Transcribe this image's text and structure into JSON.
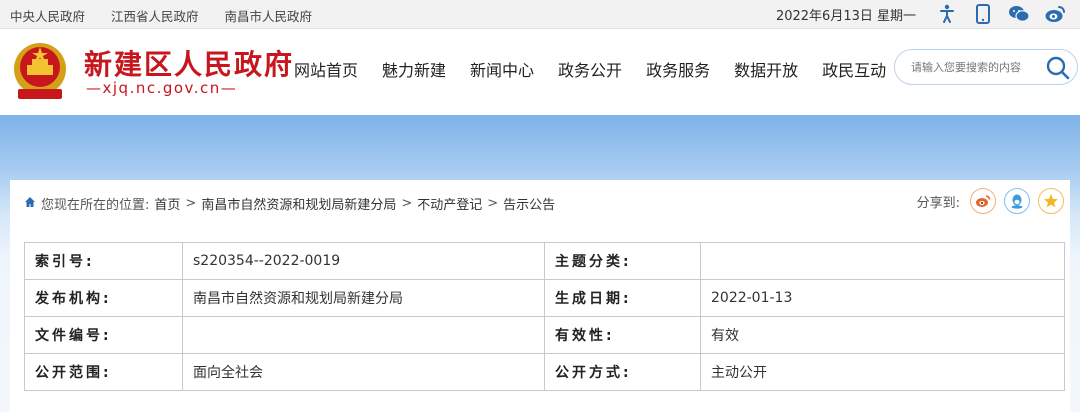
{
  "topbar": {
    "links": [
      "中央人民政府",
      "江西省人民政府",
      "南昌市人民政府"
    ],
    "date": "2022年6月13日 星期一",
    "icons": [
      "accessibility-icon",
      "mobile-icon",
      "wechat-icon",
      "weibo-icon"
    ]
  },
  "header": {
    "site_name": "新建区人民政府",
    "domain": "xjq.nc.gov.cn",
    "nav": [
      "网站首页",
      "魅力新建",
      "新闻中心",
      "政务公开",
      "政务服务",
      "数据开放",
      "政民互动"
    ],
    "search_placeholder": "请输入您要搜索的内容"
  },
  "breadcrumb": {
    "prefix": "您现在所在的位置:",
    "items": [
      "首页",
      "南昌市自然资源和规划局新建分局",
      "不动产登记",
      "告示公告"
    ],
    "separator": ">"
  },
  "share": {
    "label": "分享到:",
    "icons": [
      "weibo-share-icon",
      "qq-share-icon",
      "qzone-share-icon"
    ]
  },
  "info_table": {
    "rows": [
      [
        {
          "k": "索引号:",
          "v": "s220354--2022-0019"
        },
        {
          "k": "主题分类:",
          "v": ""
        }
      ],
      [
        {
          "k": "发布机构:",
          "v": "南昌市自然资源和规划局新建分局"
        },
        {
          "k": "生成日期:",
          "v": "2022-01-13"
        }
      ],
      [
        {
          "k": "文件编号:",
          "v": ""
        },
        {
          "k": "有效性:",
          "v": "有效"
        }
      ],
      [
        {
          "k": "公开范围:",
          "v": "面向全社会"
        },
        {
          "k": "公开方式:",
          "v": "主动公开"
        }
      ]
    ]
  },
  "colors": {
    "brand_red": "#c8161d",
    "accent_blue": "#2b6cb0"
  }
}
